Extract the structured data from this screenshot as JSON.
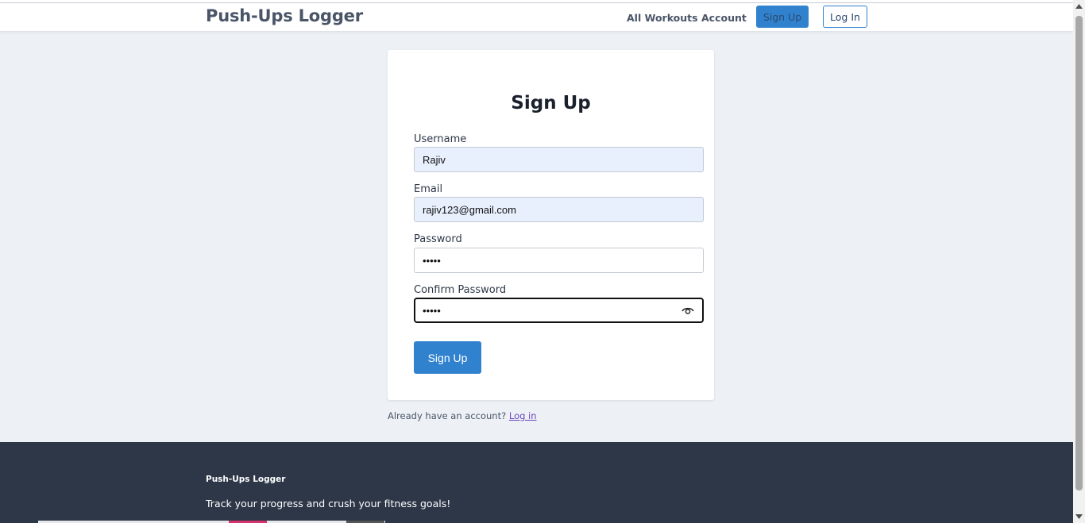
{
  "header": {
    "brand": "Push-Ups Logger",
    "nav": {
      "all_workouts": "All Workouts",
      "account": "Account",
      "sign_up": "Sign Up",
      "log_in": "Log In"
    }
  },
  "form": {
    "title": "Sign Up",
    "username_label": "Username",
    "username_value": "Rajiv",
    "email_label": "Email",
    "email_value": "rajiv123@gmail.com",
    "password_label": "Password",
    "password_value": "•••••",
    "confirm_label": "Confirm Password",
    "confirm_value": "•••••",
    "submit_label": "Sign Up"
  },
  "below_form": {
    "prompt": "Already have an account?",
    "link": "Log in"
  },
  "footer": {
    "brand": "Push-Ups Logger",
    "tagline": "Track your progress and crush your fitness goals!"
  },
  "colors": {
    "accent": "#3182ce",
    "footer_bg": "#2d3748",
    "page_bg": "#edf1f5",
    "autofill_bg": "#e8f0fe"
  }
}
